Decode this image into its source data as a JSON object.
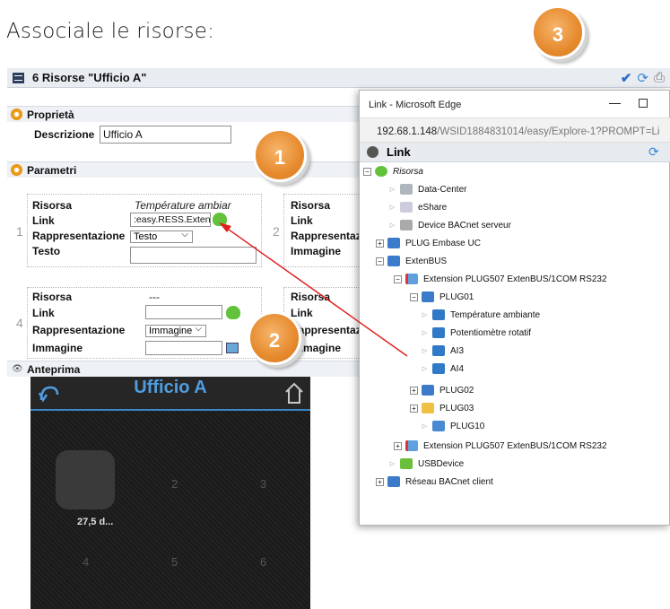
{
  "heading": "Associale le risorse:",
  "window": {
    "title": "6 Risorse \"Ufficio A\""
  },
  "sections": {
    "props": "Proprietà",
    "params": "Parametri",
    "preview": "Anteprima"
  },
  "props": {
    "desc_label": "Descrizione",
    "desc_value": "Ufficio A"
  },
  "card1": {
    "index": "1",
    "risorsa_label": "Risorsa",
    "risorsa_value": "Température ambiar",
    "link_label": "Link",
    "link_value": ":easy.RESS.Exten",
    "rep_label": "Rappresentazione",
    "rep_value": "Testo",
    "testo_label": "Testo"
  },
  "card2": {
    "index": "2",
    "risorsa_label": "Risorsa",
    "link_label": "Link",
    "rep_label": "Rappresentaz",
    "img_label": "Immagine"
  },
  "card4": {
    "index": "4",
    "risorsa_label": "Risorsa",
    "risorsa_value": "---",
    "link_label": "Link",
    "rep_label": "Rappresentazione",
    "rep_value": "Immagine",
    "img_label": "Immagine"
  },
  "card5": {
    "risorsa_label": "Risorsa",
    "link_label": "Link",
    "rep_label": "Rappresentaz",
    "img_label": "Immagine"
  },
  "preview": {
    "title": "Ufficio A",
    "tile_value": "27,5 d...",
    "numbers": [
      "2",
      "3",
      "4",
      "5",
      "6"
    ]
  },
  "edge": {
    "window_title": "Link - Microsoft Edge",
    "address": "192.68.1.148",
    "address_rest": "/WSID1884831014/easy/Explore-1?PROMPT=Li",
    "panel_title": "Link"
  },
  "tree": [
    "Risorsa",
    "Data-Center",
    "eShare",
    "Device BACnet serveur",
    "PLUG Embase UC",
    "ExtenBUS",
    "Extension PLUG507 ExtenBUS/1COM RS232",
    "PLUG01",
    "Température ambiante",
    "Potentiomètre rotatif",
    "AI3",
    "AI4",
    "PLUG02",
    "PLUG03",
    "PLUG10",
    "Extension PLUG507 ExtenBUS/1COM RS232",
    "USBDevice",
    "Réseau BACnet client"
  ],
  "callouts": [
    "1",
    "2",
    "3"
  ],
  "colors": {
    "accent": "#e68a2e",
    "link": "#4f9de0",
    "arrow": "#e02020"
  }
}
